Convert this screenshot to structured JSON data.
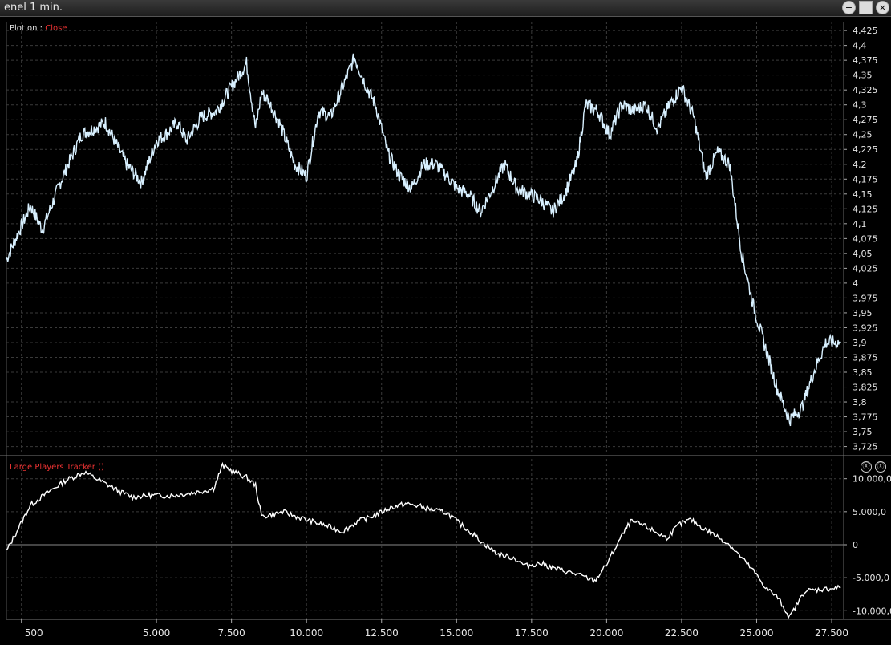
{
  "window": {
    "title": "enel  1 min.",
    "buttons": {
      "minimize": "−",
      "maximize": "",
      "close": "×"
    }
  },
  "price_panel": {
    "plot_on_label": "Plot on :",
    "plot_on_value": "Close",
    "y_ticks": [
      "4,425",
      "4,4",
      "4,375",
      "4,35",
      "4,325",
      "4,3",
      "4,275",
      "4,25",
      "4,225",
      "4,2",
      "4,175",
      "4,15",
      "4,125",
      "4,1",
      "4,075",
      "4,05",
      "4,025",
      "4",
      "3,975",
      "3,95",
      "3,925",
      "3,9",
      "3,875",
      "3,85",
      "3,825",
      "3,8",
      "3,775",
      "3,75",
      "3,725"
    ]
  },
  "indicator_panel": {
    "title": "Large Players Tracker ()",
    "y_ticks": [
      "10.000,0",
      "5.000,0",
      "0",
      "-5.000,0",
      "-10.000,0"
    ],
    "close_glyph": "ⓧ"
  },
  "x_ticks": [
    "500",
    "5.000",
    "7.500",
    "10.000",
    "12.500",
    "15.000",
    "17.500",
    "20.000",
    "22.500",
    "25.000",
    "27.500"
  ],
  "colors": {
    "price_line": "#d8f0ff",
    "indicator_line": "#ffffff",
    "grid": "#3a3a3a",
    "accent_red": "#e33333"
  },
  "chart_data": [
    {
      "type": "line",
      "title": "",
      "x_range": [
        0,
        27900
      ],
      "ylim": [
        3.715,
        4.44
      ],
      "series": [
        {
          "x": [
            0,
            800,
            1200,
            1800,
            2500,
            3300,
            4000,
            4500,
            5000,
            5300,
            5700,
            6000,
            6500,
            7000,
            7500,
            8000,
            8300,
            8500,
            8700,
            9100,
            9600,
            10000,
            10400,
            10800,
            11200,
            11600,
            12000,
            12300,
            12700,
            13100,
            13500,
            13900,
            14300,
            14700,
            15000,
            15400,
            15800,
            16200,
            16600,
            17000,
            17400,
            17800,
            18200,
            18600,
            19000,
            19300,
            19700,
            20100,
            20500,
            20900,
            21300,
            21700,
            22100,
            22500,
            22900,
            23300,
            23700,
            24100,
            24500,
            24900,
            25300,
            25700,
            26100,
            26500,
            26900,
            27300,
            27800
          ],
          "y": [
            4.04,
            4.13,
            4.09,
            4.17,
            4.25,
            4.27,
            4.2,
            4.17,
            4.24,
            4.25,
            4.27,
            4.24,
            4.28,
            4.29,
            4.33,
            4.37,
            4.26,
            4.32,
            4.31,
            4.27,
            4.2,
            4.18,
            4.29,
            4.28,
            4.33,
            4.38,
            4.33,
            4.3,
            4.22,
            4.18,
            4.16,
            4.2,
            4.2,
            4.18,
            4.16,
            4.15,
            4.12,
            4.16,
            4.2,
            4.16,
            4.15,
            4.14,
            4.12,
            4.15,
            4.2,
            4.3,
            4.29,
            4.25,
            4.3,
            4.29,
            4.3,
            4.26,
            4.3,
            4.33,
            4.28,
            4.18,
            4.22,
            4.2,
            4.05,
            3.96,
            3.89,
            3.82,
            3.77,
            3.79,
            3.85,
            3.9,
            3.9
          ]
        }
      ]
    },
    {
      "type": "line",
      "title": "",
      "x_range": [
        0,
        27900
      ],
      "ylim": [
        -11300,
        13000
      ],
      "series": [
        {
          "x": [
            0,
            800,
            1400,
            2000,
            2600,
            3200,
            3800,
            4200,
            4800,
            5400,
            5800,
            6400,
            6900,
            7200,
            7600,
            8000,
            8300,
            8500,
            8700,
            9200,
            9700,
            10200,
            10700,
            11200,
            11700,
            12300,
            12800,
            13300,
            13800,
            14200,
            14700,
            15100,
            15500,
            15900,
            16400,
            16900,
            17300,
            17800,
            18200,
            18600,
            19100,
            19600,
            20000,
            20400,
            20800,
            21200,
            21600,
            22000,
            22400,
            22800,
            23200,
            23600,
            24100,
            24500,
            24900,
            25300,
            25700,
            26100,
            26600,
            27100,
            27800
          ],
          "y": [
            -1000,
            6000,
            8000,
            9800,
            11000,
            9500,
            8000,
            7200,
            7500,
            7400,
            7600,
            8000,
            8500,
            12000,
            11000,
            10200,
            9000,
            4300,
            4400,
            5000,
            4200,
            3500,
            2800,
            2000,
            3500,
            4500,
            5600,
            6200,
            5800,
            5300,
            4800,
            3200,
            1800,
            200,
            -1500,
            -2000,
            -3200,
            -2800,
            -3500,
            -4000,
            -4600,
            -5500,
            -3000,
            500,
            3500,
            3000,
            2000,
            1000,
            3000,
            3800,
            2500,
            1500,
            0,
            -2000,
            -4000,
            -6500,
            -8000,
            -11000,
            -7000,
            -6800,
            -6500
          ]
        }
      ]
    }
  ]
}
